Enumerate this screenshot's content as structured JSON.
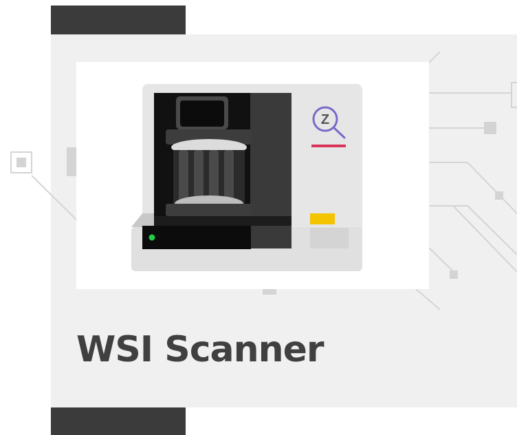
{
  "title": "WSI Scanner",
  "icons": {
    "device": "slide-scanner-icon",
    "brand": "magnifier-z-icon"
  },
  "brand_letter": "Z",
  "colors": {
    "title": "#404040",
    "panel": "#f0f0f0",
    "dark_bar": "#3b3b3b",
    "brand_purple": "#7b68c8",
    "accent_red": "#d9345a",
    "indicator_yellow": "#f5c400",
    "led_green": "#22cc44"
  }
}
